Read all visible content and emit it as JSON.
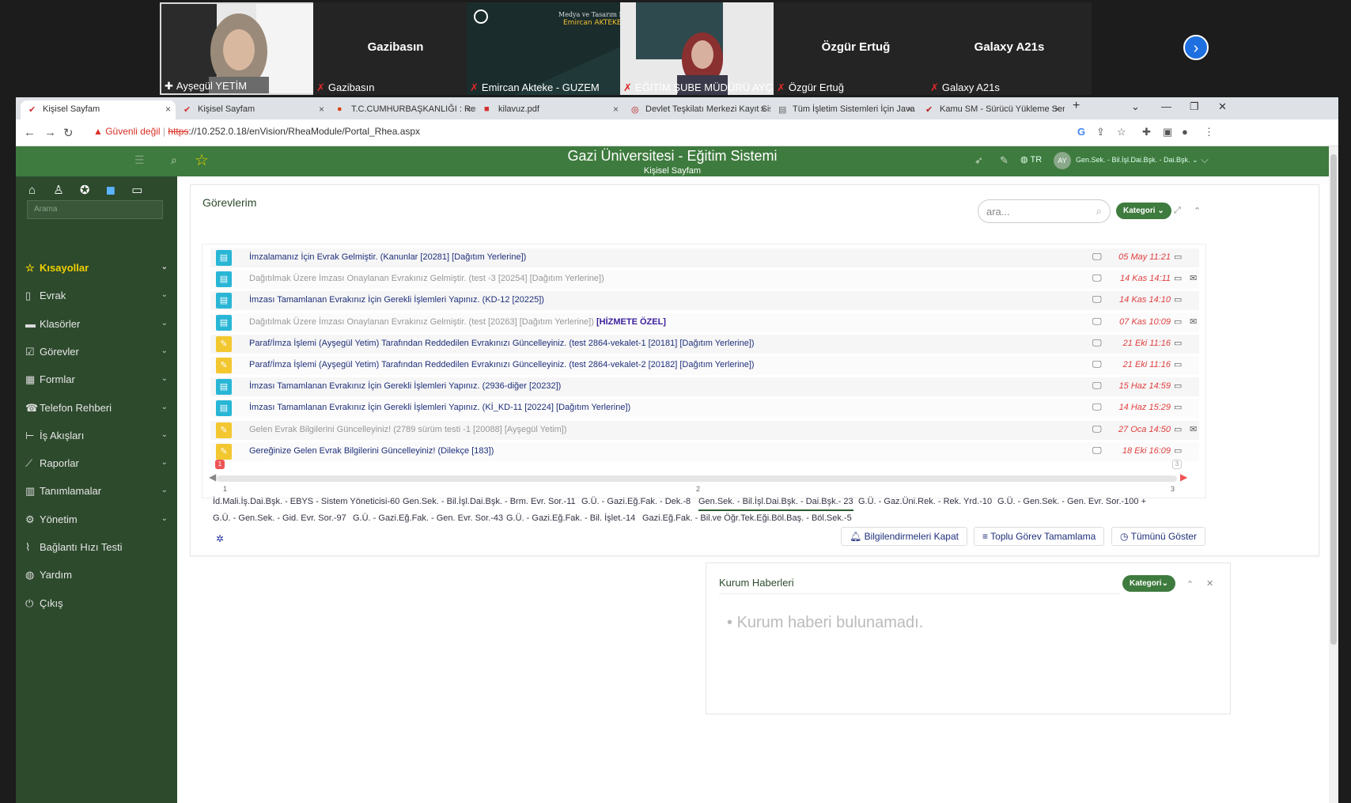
{
  "zoom": {
    "participants": [
      {
        "name": "Ayşegül YETİM",
        "video": true,
        "pinned": true
      },
      {
        "name": "Gazibasın",
        "big": "Gazibasın"
      },
      {
        "name": "Emircan Akteke - GUZEM",
        "video": true,
        "overlay": [
          "Medya ve Tasarım Ekibi",
          "Emircan AKTEKE"
        ]
      },
      {
        "name": "EĞİTİM ŞUBE MÜDÜRÜ AYÇA ...",
        "video": true
      },
      {
        "name": "Özgür Ertuğ",
        "big": "Özgür Ertuğ"
      },
      {
        "name": "Galaxy A21s",
        "big": "Galaxy A21s"
      }
    ],
    "next_icon": "chevron-right-icon"
  },
  "browser": {
    "tabs": [
      {
        "label": "Kişisel Sayfam",
        "active": true
      },
      {
        "label": "Kişisel Sayfam"
      },
      {
        "label": "T.C.CUMHURBAŞKANLIĞI : Resmi"
      },
      {
        "label": "kilavuz.pdf"
      },
      {
        "label": "Devlet Teşkilatı Merkezi Kayıt Sis"
      },
      {
        "label": "Tüm İşletim Sistemleri İçin Java"
      },
      {
        "label": "Kamu SM - Sürücü Yükleme Serv"
      }
    ],
    "new_tab": "+",
    "security": "Güvenli değil",
    "url_scheme": "https",
    "url_rest": "://10.252.0.18/enVision/RheaModule/Portal_Rhea.aspx"
  },
  "app": {
    "title": "Gazi Üniversitesi - Eğitim Sistemi",
    "subtitle": "Kişisel Sayfam",
    "lang": "TR",
    "user_initials": "AY",
    "user_role": "Gen.Sek. - Bil.İşl.Dai.Bşk. - Dai.Bşk."
  },
  "sidebar": {
    "search_placeholder": "Arama",
    "items": [
      {
        "label": "Kısayollar",
        "icon": "star-icon",
        "highlight": true,
        "chev": true
      },
      {
        "label": "Evrak",
        "icon": "document-icon",
        "chev": true
      },
      {
        "label": "Klasörler",
        "icon": "folder-icon",
        "chev": true
      },
      {
        "label": "Görevler",
        "icon": "check-square-icon",
        "chev": true
      },
      {
        "label": "Formlar",
        "icon": "form-icon",
        "chev": true
      },
      {
        "label": "Telefon Rehberi",
        "icon": "phone-icon",
        "chev": true
      },
      {
        "label": "İş Akışları",
        "icon": "workflow-icon",
        "chev": true
      },
      {
        "label": "Raporlar",
        "icon": "chart-icon",
        "chev": true
      },
      {
        "label": "Tanımlamalar",
        "icon": "settings-doc-icon",
        "chev": true
      },
      {
        "label": "Yönetim",
        "icon": "gear-icon",
        "chev": true
      },
      {
        "label": "Bağlantı Hızı Testi",
        "icon": "speed-icon"
      },
      {
        "label": "Yardım",
        "icon": "globe-icon"
      },
      {
        "label": "Çıkış",
        "icon": "power-icon"
      }
    ]
  },
  "tasks": {
    "title": "Görevlerim",
    "search_placeholder": "ara...",
    "kategori": "Kategori",
    "rows": [
      {
        "text": "İmzalamanız İçin Evrak Gelmiştir. (Kanunlar [20281] [Dağıtım Yerlerine])",
        "date": "05 May 11:21",
        "kind": "doc",
        "gray": false,
        "mail": false
      },
      {
        "text": "Dağıtılmak Üzere İmzası Onaylanan Evrakınız Gelmiştir. (test -3 [20254] [Dağıtım Yerlerine])",
        "date": "14 Kas 14:11",
        "kind": "doc",
        "gray": true,
        "mail": true
      },
      {
        "text": "İmzası Tamamlanan Evrakınız İçin Gerekli İşlemleri Yapınız. (KD-12 [20225])",
        "date": "14 Kas 14:10",
        "kind": "doc",
        "gray": false,
        "mail": false
      },
      {
        "text": "Dağıtılmak Üzere İmzası Onaylanan Evrakınız Gelmiştir. (test [20263] [Dağıtım Yerlerine])",
        "tag": "[HİZMETE ÖZEL]",
        "date": "07 Kas 10:09",
        "kind": "doc",
        "gray": true,
        "mail": true
      },
      {
        "text": "Paraf/İmza İşlemi (Ayşegül Yetim) Tarafından Reddedilen Evrakınızı Güncelleyiniz. (test 2864-vekalet-1 [20181] [Dağıtım Yerlerine])",
        "date": "21 Eki 11:16",
        "kind": "edit",
        "gray": false,
        "mail": false
      },
      {
        "text": "Paraf/İmza İşlemi (Ayşegül Yetim) Tarafından Reddedilen Evrakınızı Güncelleyiniz. (test 2864-vekalet-2 [20182] [Dağıtım Yerlerine])",
        "date": "21 Eki 11:16",
        "kind": "edit",
        "gray": false,
        "mail": false
      },
      {
        "text": "İmzası Tamamlanan Evrakınız İçin Gerekli İşlemleri Yapınız. (2936-diğer [20232])",
        "date": "15 Haz 14:59",
        "kind": "doc",
        "gray": false,
        "mail": false
      },
      {
        "text": "İmzası Tamamlanan Evrakınız İçin Gerekli İşlemleri Yapınız. (Kİ_KD-11 [20224] [Dağıtım Yerlerine])",
        "date": "14 Haz 15:29",
        "kind": "doc",
        "gray": false,
        "mail": false
      },
      {
        "text": "Gelen Evrak Bilgilerini Güncelleyiniz! (2789 sürüm testi -1 [20088] [Ayşegül Yetim])",
        "date": "27 Oca 14:50",
        "kind": "edit",
        "gray": true,
        "mail": true
      },
      {
        "text": "Gereğinize Gelen Evrak Bilgilerini Güncelleyiniz! (Dilekçe [183])",
        "date": "18 Eki 16:09",
        "kind": "edit",
        "gray": false,
        "mail": false
      }
    ],
    "slider": {
      "badge": "1",
      "end_badge": "3",
      "ticks": [
        "1",
        "2",
        "3"
      ]
    },
    "roles": [
      {
        "label": "İd.Mali.İş.Dai.Bşk. - EBYS - Sistem Yöneticisi-60"
      },
      {
        "label": "Gen.Sek. - Bil.İşl.Dai.Bşk. - Brm. Evr. Sor.-11"
      },
      {
        "label": "G.Ü. - Gazi.Eğ.Fak. - Dek.-8"
      },
      {
        "label": "Gen.Sek. - Bil.İşl.Dai.Bşk. - Dai.Bşk.- 23",
        "active": true
      },
      {
        "label": "G.Ü. - Gaz.Üni.Rek. - Rek. Yrd.-10"
      },
      {
        "label": "G.Ü. - Gen.Sek. - Gen. Evr. Sor.-100 +"
      },
      {
        "label": "G.Ü. - Gen.Sek. - Gid. Evr. Sor.-97"
      },
      {
        "label": "G.Ü. - Gazi.Eğ.Fak. - Gen. Evr. Sor.-43"
      },
      {
        "label": "G.Ü. - Gazi.Eğ.Fak. - Bil. İşlet.-14"
      },
      {
        "label": "Gazi.Eğ.Fak. - Bil.ve Öğr.Tek.Eği.Böl.Baş. - Böl.Sek.-5"
      }
    ],
    "actions": [
      "Bilgilendirmeleri Kapat",
      "Toplu Görev Tamamlama",
      "Tümünü Göster"
    ]
  },
  "news": {
    "title": "Kurum Haberleri",
    "kategori": "Kategori",
    "empty": "Kurum haberi bulunamadı."
  },
  "colors": {
    "header": "#3e7b3e",
    "sidebar": "#2d4a2d",
    "doc": "#29b6d6",
    "edit": "#f3c730",
    "date": "#e03e3e",
    "link": "#1e2f7a"
  }
}
